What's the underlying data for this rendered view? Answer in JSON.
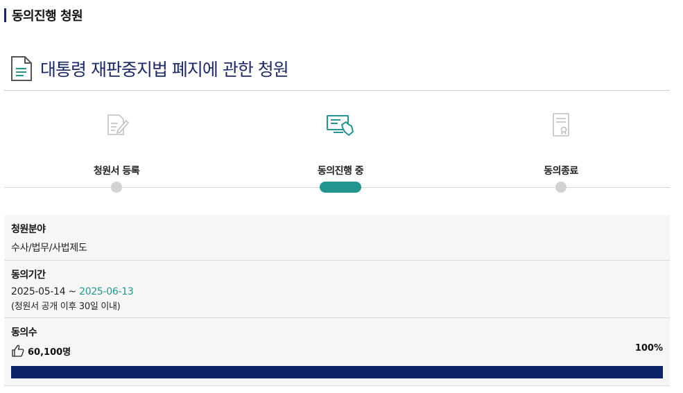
{
  "section": {
    "title": "동의진행 청원"
  },
  "petition": {
    "title": "대통령 재판중지법 폐지에 관한 청원"
  },
  "steps": [
    {
      "label": "청원서 등록",
      "icon": "edit-document-icon",
      "state": "done"
    },
    {
      "label": "동의진행 중",
      "icon": "computer-hand-icon",
      "state": "active"
    },
    {
      "label": "동의종료",
      "icon": "certificate-icon",
      "state": "pending"
    }
  ],
  "info": {
    "field_label": "청원분야",
    "field_value": "수사/법무/사법제도",
    "period_label": "동의기간",
    "period_start": "2025-05-14",
    "period_sep": " ~ ",
    "period_end": "2025-06-13",
    "period_note": "(청원서 공개 이후 30일 이내)",
    "count_label": "동의수",
    "count_value": "60,100명",
    "percent": "100%",
    "progress_fraction": 1.0
  },
  "colors": {
    "accent_teal": "#22968e",
    "navy": "#1c2a6a",
    "progress": "#0d2468"
  }
}
